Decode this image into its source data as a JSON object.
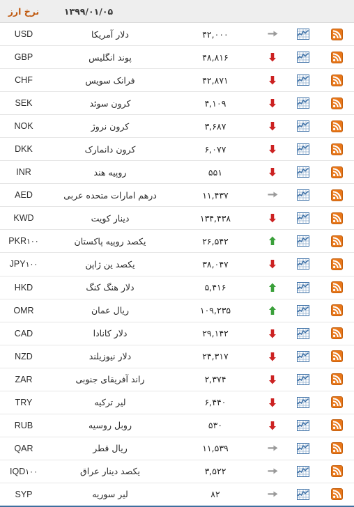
{
  "header": {
    "title": "نرخ ارز",
    "date": "۱۳۹۹/۰۱/۰۵"
  },
  "icons": {
    "rss": "rss-feed-icon",
    "chart": "price-chart-icon",
    "up": "arrow-up-icon",
    "down": "arrow-down-icon",
    "flat": "arrow-right-icon"
  },
  "colors": {
    "header_bg": "#eeeeee",
    "title": "#c05a10",
    "rss_orange": "#e8771a",
    "chart_blue": "#3a6ea5",
    "up_green": "#3aa03a",
    "down_red": "#cc2222",
    "flat_gray": "#9a9a9a",
    "row_border": "#e6e6e6",
    "bottom_rule": "#3f6f9f"
  },
  "rows": [
    {
      "code": "USD",
      "mult": "",
      "name": "دلار آمریکا",
      "price": "۴۲,۰۰۰",
      "trend": "flat"
    },
    {
      "code": "GBP",
      "mult": "",
      "name": "پوند انگلیس",
      "price": "۴۸,۸۱۶",
      "trend": "down"
    },
    {
      "code": "CHF",
      "mult": "",
      "name": "فرانک سویس",
      "price": "۴۲,۸۷۱",
      "trend": "down"
    },
    {
      "code": "SEK",
      "mult": "",
      "name": "کرون سوئد",
      "price": "۴,۱۰۹",
      "trend": "down"
    },
    {
      "code": "NOK",
      "mult": "",
      "name": "کرون نروژ",
      "price": "۳,۶۸۷",
      "trend": "down"
    },
    {
      "code": "DKK",
      "mult": "",
      "name": "کرون دانمارک",
      "price": "۶,۰۷۷",
      "trend": "down"
    },
    {
      "code": "INR",
      "mult": "",
      "name": "روپیه هند",
      "price": "۵۵۱",
      "trend": "down"
    },
    {
      "code": "AED",
      "mult": "",
      "name": "درهم امارات متحده عربی",
      "price": "۱۱,۴۳۷",
      "trend": "flat"
    },
    {
      "code": "KWD",
      "mult": "",
      "name": "دینار کویت",
      "price": "۱۳۴,۴۳۸",
      "trend": "down"
    },
    {
      "code": "PKR",
      "mult": "۱۰۰",
      "name": "یکصد روپیه پاکستان",
      "price": "۲۶,۵۴۲",
      "trend": "up"
    },
    {
      "code": "JPY",
      "mult": "۱۰۰",
      "name": "یکصد ین ژاپن",
      "price": "۳۸,۰۴۷",
      "trend": "down"
    },
    {
      "code": "HKD",
      "mult": "",
      "name": "دلار هنگ کنگ",
      "price": "۵,۴۱۶",
      "trend": "up"
    },
    {
      "code": "OMR",
      "mult": "",
      "name": "ریال عمان",
      "price": "۱۰۹,۲۳۵",
      "trend": "up"
    },
    {
      "code": "CAD",
      "mult": "",
      "name": "دلار کانادا",
      "price": "۲۹,۱۴۲",
      "trend": "down"
    },
    {
      "code": "NZD",
      "mult": "",
      "name": "دلار نیوزیلند",
      "price": "۲۴,۳۱۷",
      "trend": "down"
    },
    {
      "code": "ZAR",
      "mult": "",
      "name": "راند آفریقای جنوبی",
      "price": "۲,۳۷۴",
      "trend": "down"
    },
    {
      "code": "TRY",
      "mult": "",
      "name": "لیر ترکیه",
      "price": "۶,۴۴۰",
      "trend": "down"
    },
    {
      "code": "RUB",
      "mult": "",
      "name": "روبل روسیه",
      "price": "۵۳۰",
      "trend": "down"
    },
    {
      "code": "QAR",
      "mult": "",
      "name": "ریال قطر",
      "price": "۱۱,۵۳۹",
      "trend": "flat"
    },
    {
      "code": "IQD",
      "mult": "۱۰۰",
      "name": "یکصد دینار عراق",
      "price": "۳,۵۲۲",
      "trend": "flat"
    },
    {
      "code": "SYP",
      "mult": "",
      "name": "لیر سوریه",
      "price": "۸۲",
      "trend": "flat"
    }
  ]
}
